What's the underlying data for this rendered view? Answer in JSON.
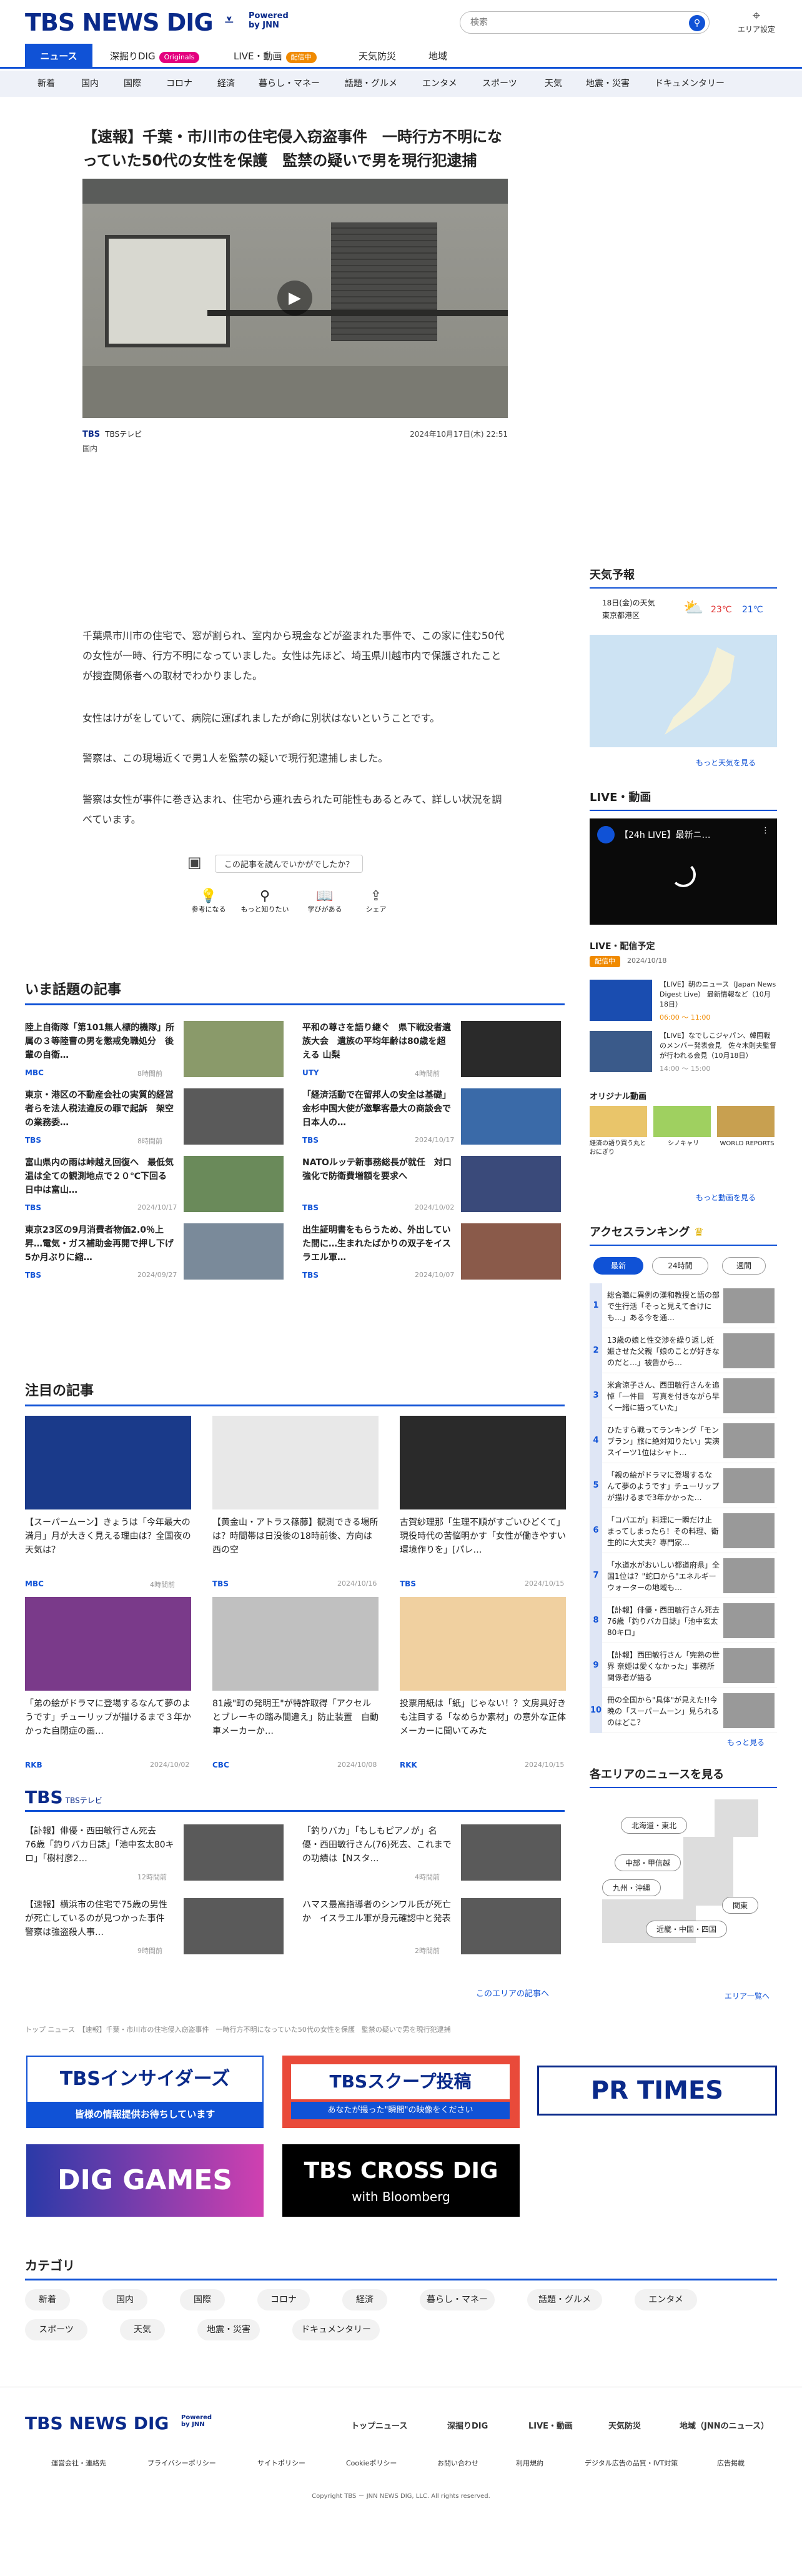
{
  "header": {
    "logo": "TBS NEWS DIG",
    "powered_by": "Powered by JNN",
    "search_placeholder": "検索",
    "area_setting": "エリア設定"
  },
  "nav_primary": [
    "ニュース",
    "深掘りDIG",
    "LIVE・動画",
    "天気防災",
    "地域"
  ],
  "nav_badges": {
    "originals": "Originals",
    "live": "配信中"
  },
  "nav_secondary": [
    "新着",
    "国内",
    "国際",
    "コロナ",
    "経済",
    "暮らし・マネー",
    "話題・グルメ",
    "エンタメ",
    "スポーツ",
    "天気",
    "地震・災害",
    "ドキュメンタリー"
  ],
  "article": {
    "headline": "【速報】千葉・市川市の住宅侵入窃盗事件　一時行方不明になっていた50代の女性を保護　監禁の疑いで男を現行犯逮捕",
    "source": "TBS",
    "source_name": "TBSテレビ",
    "category": "国内",
    "date": "2024年10月17日(木) 22:51",
    "paragraphs": [
      "千葉県市川市の住宅で、窓が割られ、室内から現金などが盗まれた事件で、この家に住む50代の女性が一時、行方不明になっていました。女性は先ほど、埼玉県川越市内で保護されたことが捜査関係者への取材でわかりました。",
      "女性はけがをしていて、病院に運ばれましたが命に別状はないということです。",
      "警察は、この現場近くで男1人を監禁の疑いで現行犯逮捕しました。",
      "警察は女性が事件に巻き込まれ、住宅から連れ去られた可能性もあるとみて、詳しい状況を調べています。"
    ],
    "feedback_prompt": "この記事を読んでいかがでしたか？",
    "reactions": [
      "参考になる",
      "もっと知りたい",
      "学びがある",
      "シェア"
    ]
  },
  "weather": {
    "title": "天気予報",
    "date_label": "18日(金)の天気",
    "location": "東京都港区",
    "high": "23℃",
    "low": "21℃",
    "more": "もっと天気を見る"
  },
  "live": {
    "title": "LIVE・動画",
    "video_title": "【24h LIVE】最新ニ…",
    "schedule_title": "LIVE・配信予定",
    "schedule_badge": "配信中",
    "schedule_date": "2024/10/18",
    "items": [
      {
        "title": "【LIVE】朝のニュース（Japan News Digest Live） 最新情報など（10月18日）",
        "time": "06:00 〜 11:00"
      },
      {
        "title": "【LIVE】なでしこジャパン、韓国戦のメンバー発表会見　佐々木則夫監督が行われる会見（10月18日）",
        "time": "14:00 〜 15:00"
      }
    ],
    "original_title": "オリジナル動画",
    "originals": [
      "経済の語り買う丸とおにぎり",
      "シノキャリ",
      "WORLD REPORTS"
    ],
    "more": "もっと動画を見る"
  },
  "ranking": {
    "title": "アクセスランキング",
    "tabs": [
      "最新",
      "24時間",
      "週間"
    ],
    "items": [
      "総合職に異例の漢和教授と語の部で生行活「そっと見えて合けにも…」ある今を通…",
      "13歳の娘と性交渉を繰り返し妊娠させた父親「娘のことが好きなのだと…」被告から…",
      "米倉涼子さん、西田敏行さんを追悼「一件目　写真を付きながら早く一緒に語っていた」",
      "ひたすら戦ってランキング「モンブラン」旅に絶対知りたい」実演スイーツ1位はシャト…",
      "「親の絵がドラマに登場するなんて夢のようです」チューリップが描けるまで3年かかった…",
      "「コバエが」料理に一瞬だけ止まってしまったら！その料理、衛生的に大丈夫？専門家…",
      "「水道水がおいしい都道府県」全国1位は？\"蛇口から\"エネルギーウォーターの地域も…",
      "【訃報】俳優・西田敏行さん死去　76歳「釣りバカ日誌」「池中玄太80キロ」",
      "【訃報】西田敏行さん「完熟の世界 奈姫は愛くなかった」事務所関係者が語る",
      "冊の全国から\"具体\"が見えた!!今晩の「スーパームーン」見られるのはどこ？"
    ],
    "more": "もっと見る"
  },
  "regions": {
    "title": "各エリアのニュースを見る",
    "areas": [
      "北海道・東北",
      "中部・甲信越",
      "九州・沖縄",
      "関東",
      "近畿・中国・四国"
    ],
    "more": "エリア一覧へ"
  },
  "trending": {
    "title": "いま話題の記事",
    "items": [
      {
        "title": "陸上自衛隊「第101無人標的機隊」所属の３等陸曹の男を懲戒免職処分　後輩の自衛…",
        "source": "MBC",
        "date": "8時間前"
      },
      {
        "title": "平和の尊さを語り継ぐ　県下戦没者遺族大会　遺族の平均年齢は80歳を超える 山梨",
        "source": "UTY",
        "date": "4時間前"
      },
      {
        "title": "東京・港区の不動産会社の実質的経営者らを法人税法違反の罪で起訴　架空の業務委…",
        "source": "TBS",
        "date": "8時間前"
      },
      {
        "title": "「経済活動で在留邦人の安全は基礎」金杉中国大使が邀撃客最大の商談会で日本人の…",
        "source": "TBS",
        "date": "2024/10/17"
      },
      {
        "title": "富山県内の雨は峠越え回復へ　最低気温は全ての観測地点で２０℃下回る　日中は富山…",
        "source": "TBS",
        "date": "2024/10/17"
      },
      {
        "title": "NATOルッテ新事務総長が就任　対口強化で防衛費増額を要求へ",
        "source": "TBS",
        "date": "2024/10/02"
      },
      {
        "title": "東京23区の9月消費者物価2.0％上昇…電気・ガス補助金再開で押し下げ5か月ぶりに縮…",
        "source": "TBS",
        "date": "2024/09/27"
      },
      {
        "title": "出生証明書をもらうため、外出していた間に…生まれたばかりの双子をイスラエル軍…",
        "source": "TBS",
        "date": "2024/10/07"
      }
    ]
  },
  "featured": {
    "title": "注目の記事",
    "items": [
      {
        "title": "【スーパームーン】きょうは「今年最大の満月」月が大きく見える理由は？全国夜の天気は？",
        "source": "MBC",
        "date": "4時間前"
      },
      {
        "title": "【黄金山・アトラス篠藤】観測できる場所は？時間帯は日没後の18時前後、方向は西の空",
        "source": "TBS",
        "date": "2024/10/16"
      },
      {
        "title": "古賀紗理那「生理不順がすごいひどくて」現役時代の苦悩明かす「女性が働きやすい環境作りを」[パレ…",
        "source": "TBS",
        "date": "2024/10/15"
      },
      {
        "title": "「弟の絵がドラマに登場するなんて夢のようです」チューリップが描けるまで３年かかった自閉症の画…",
        "source": "RKB",
        "date": "2024/10/02"
      },
      {
        "title": "81歳\"町の発明王\"が特許取得「アクセルとブレーキの踏み間違え」防止装置　自動車メーカーか…",
        "source": "CBC",
        "date": "2024/10/08"
      },
      {
        "title": "投票用紙は「紙」じゃない！？文房具好きも注目する「なめらか素材」の意外な正体 メーカーに聞いてみた",
        "source": "RKK",
        "date": "2024/10/15"
      }
    ]
  },
  "tbs_block": {
    "logo": "TBS",
    "logo_sub": "TBSテレビ",
    "items": [
      {
        "title": "【訃報】俳優・西田敏行さん死去　76歳「釣りバカ日誌」「池中玄太80キロ」「樹村彦2…",
        "date": "12時間前"
      },
      {
        "title": "「釣りバカ」「もしもピアノが」名優・西田敏行さん(76)死去、これまでの功績は【Nスタ…",
        "date": "4時間前"
      },
      {
        "title": "【速報】横浜市の住宅で75歳の男性が死亡しているのが見つかった事件　警察は強盗殺人事…",
        "date": "9時間前"
      },
      {
        "title": "ハマス最高指導者のシンワル氏が死亡か　イスラエル軍が身元確認中と発表",
        "date": "2時間前"
      }
    ],
    "more": "このエリアの記事へ"
  },
  "breadcrumb": "トップ ニュース　【速報】千葉・市川市の住宅侵入窃盗事件　一時行方不明になっていた50代の女性を保護　監禁の疑いで男を現行犯逮捕",
  "banners": {
    "insiders": "TBSインサイダーズ",
    "insiders_sub": "皆様の情報提供お待ちしています",
    "scoop": "TBSスクープ投稿",
    "scoop_sub": "あなたが撮った\"瞬間\"の映像をください",
    "prtimes": "PR TIMES",
    "games": "DIG GAMES",
    "crossdig": "TBS CROSS DIG",
    "crossdig_sub": "with Bloomberg"
  },
  "categories": {
    "title": "カテゴリ",
    "items": [
      "新着",
      "国内",
      "国際",
      "コロナ",
      "経済",
      "暮らし・マネー",
      "話題・グルメ",
      "エンタメ",
      "スポーツ",
      "天気",
      "地震・災害",
      "ドキュメンタリー"
    ]
  },
  "footer": {
    "nav": [
      "トップニュース",
      "深掘りDIG",
      "LIVE・動画",
      "天気防災",
      "地域（JNNのニュース）"
    ],
    "links": [
      "運営会社・連絡先",
      "プライバシーポリシー",
      "サイトポリシー",
      "Cookieポリシー",
      "お問い合わせ",
      "利用規約",
      "デジタル広告の品質・IVT対策",
      "広告掲載"
    ],
    "copyright": "Copyright TBS － JNN NEWS DIG, LLC. All rights reserved."
  },
  "colors": {
    "brand": "#0a2a8a",
    "accent": "#1052d6",
    "pink": "#e4007f",
    "live": "#f08a00"
  }
}
